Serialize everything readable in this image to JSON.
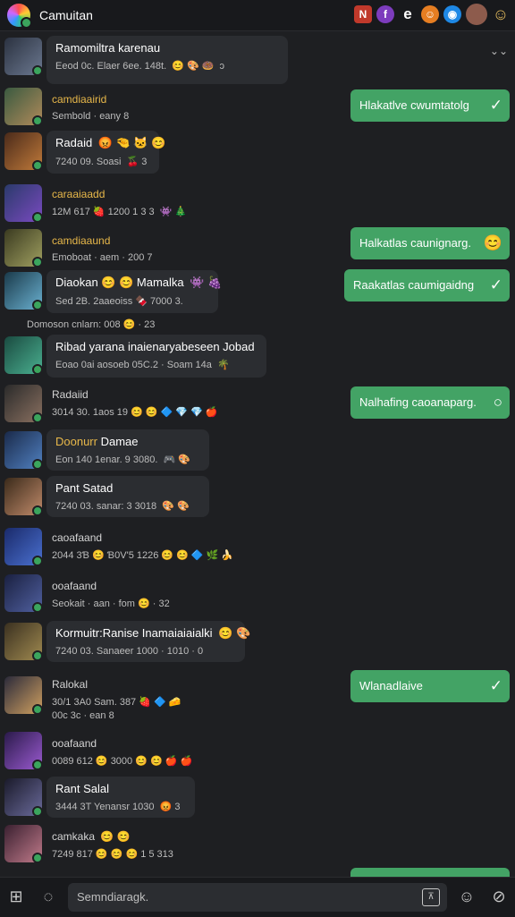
{
  "header": {
    "app_title": "Camuitan",
    "icons": [
      "n-badge-icon",
      "f-badge-icon",
      "e-icon",
      "emoji-icon",
      "blue-badge-icon",
      "user-avatar-icon",
      "smile-icon"
    ]
  },
  "messages": [
    {
      "id": 0,
      "name": "Ramomiltra karenau",
      "meta": "Eeod 0c. Elaer 6ee. 148t.",
      "emoji": "😊 🎨 🍩",
      "tail": "ɔ",
      "colors": [
        "#2b3240",
        "#6b7890"
      ]
    },
    {
      "id": 1,
      "name": "camdiaairid",
      "meta": "Sembold · eany 8",
      "colors": [
        "#3a5a40",
        "#b08a5a"
      ]
    },
    {
      "id": 2,
      "name": "Radaid",
      "emoji_name": "😡 🤏 🐱 😊",
      "meta": "7240 09. Soasi",
      "emoji": "🍒 3",
      "colors": [
        "#4a2a1a",
        "#c07a3a"
      ]
    },
    {
      "id": 3,
      "name": "caraaiaadd",
      "meta": "12M 617 🍓 1200 1 3 3",
      "emoji": "👾 🎄",
      "colors": [
        "#2a3a6a",
        "#7a4ac0"
      ]
    },
    {
      "id": 4,
      "name": "camdiaaund",
      "meta": "Emoboat · aem · 200 7",
      "colors": [
        "#3a3a20",
        "#a0a060"
      ]
    },
    {
      "id": 5,
      "name": "Diaokan 😊 😊 Mamalka",
      "emoji_name": "👾 🍇",
      "meta": "Sed 2B. 2aaeoiss 🍫 7000 3.",
      "colors": [
        "#1a3a4a",
        "#6ab0d0"
      ]
    },
    {
      "id": 6,
      "plain": "Domoson cnlarn: 008 😊 · 23"
    },
    {
      "id": 7,
      "name": "Ribad yarana inaienaryabeseen Jobad",
      "meta": "Eoao 0ai aosoeb 05C.2 · Soam 14a",
      "emoji": "🌴",
      "colors": [
        "#1a4a40",
        "#4ab090"
      ]
    },
    {
      "id": 8,
      "name": "Radaiid",
      "meta": "3014 30. 1aos 19 😊 😊 🔷 💎 💎 🍎",
      "colors": [
        "#2a2a2a",
        "#8a7060"
      ]
    },
    {
      "id": 9,
      "name": "Doonurr",
      "name_tail": "Damae",
      "meta": "Eon 140 1enar. 9 3080.",
      "emoji": "🎮 🎨",
      "colors": [
        "#1a2a4a",
        "#5080c0"
      ]
    },
    {
      "id": 10,
      "name": "Pant Satad",
      "meta": "7240 03. sanar: 3 3018",
      "emoji": "🎨 🎨",
      "colors": [
        "#3a2a1a",
        "#c08a6a"
      ]
    },
    {
      "id": 11,
      "name": "caoafaand",
      "meta": "2044 3Ɓ 😊 Ɓ0V'5 1226 😊 😊 🔷 🌿 🍌",
      "colors": [
        "#1a2a6a",
        "#4a70d0"
      ]
    },
    {
      "id": 12,
      "name": "ooafaand",
      "meta": "Seokait · aan · fom 😊 · 32",
      "colors": [
        "#1a2040",
        "#5060a0"
      ]
    },
    {
      "id": 13,
      "name": "Kormuitr:Ranise Inamaiaiaialki",
      "emoji_name": "😊 🎨",
      "meta": "7240 03. Sanaeer 1000 · 1010 · 0",
      "colors": [
        "#3a3020",
        "#a08a50"
      ]
    },
    {
      "id": 14,
      "name": "Ralokal",
      "meta": "30/1 3A0 Sam. 387 🍓 🔷 🧀",
      "meta2": "00c 3c · ean 8",
      "colors": [
        "#2a2a3a",
        "#d0a060"
      ]
    },
    {
      "id": 15,
      "name": "ooafaand",
      "meta": "0089 612 😊 3000 😊 😊 🍎 🍎",
      "colors": [
        "#2a1a4a",
        "#9a5ad0"
      ]
    },
    {
      "id": 16,
      "name": "Rant Salal",
      "meta": "3444 3T Yenansr 1030",
      "emoji": "😡 3",
      "colors": [
        "#1a1a2a",
        "#6a6a9a"
      ]
    },
    {
      "id": 17,
      "name": "camkaka",
      "emoji_name": "😊 😊",
      "meta": "7249 817 😊 😊 😊 1 5 313",
      "colors": [
        "#3a2030",
        "#c07a8a"
      ]
    }
  ],
  "outgoing": [
    {
      "id": 0,
      "text": "Hlakatlve cwumtatolg",
      "mark": "✓"
    },
    {
      "id": 1,
      "text": "Halkatlas caunignarg.",
      "mark": "😊"
    },
    {
      "id": 2,
      "text": "Raakatlas caumigaidng",
      "mark": "✓"
    },
    {
      "id": 3,
      "text": "Nalhafing caoanaparg.",
      "mark": "○"
    },
    {
      "id": 4,
      "text": "Wlanadlaive",
      "mark": "✓"
    }
  ],
  "composer": {
    "placeholder": "Semndiaragk.",
    "gif": "⊼"
  }
}
